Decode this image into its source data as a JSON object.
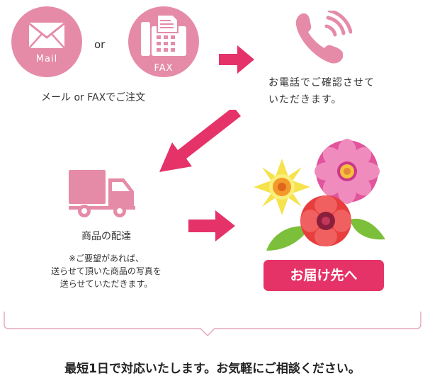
{
  "step1": {
    "mail_label": "Mail",
    "or_text": "or",
    "fax_label": "FAX",
    "caption": "メール or FAXでご注文"
  },
  "step2": {
    "caption_line1": "お電話でご確認させて",
    "caption_line2": "いただきます。"
  },
  "step3": {
    "caption": "商品の配達",
    "note_line1": "※ご要望があれば、",
    "note_line2": "送らせて頂いた商品の写真を",
    "note_line3": "送らせていただきます。"
  },
  "step4": {
    "badge_label": "お届け先へ"
  },
  "footer": {
    "message": "最短1日で対応いたします。お気軽にご相談ください。"
  },
  "colors": {
    "pink_icon": "#e58ba8",
    "arrow": "#e5336a",
    "badge": "#e53367",
    "bracket": "#e7a9bd"
  },
  "icons": [
    "mail-icon",
    "fax-icon",
    "phone-icon",
    "truck-icon",
    "flowers-icon"
  ]
}
